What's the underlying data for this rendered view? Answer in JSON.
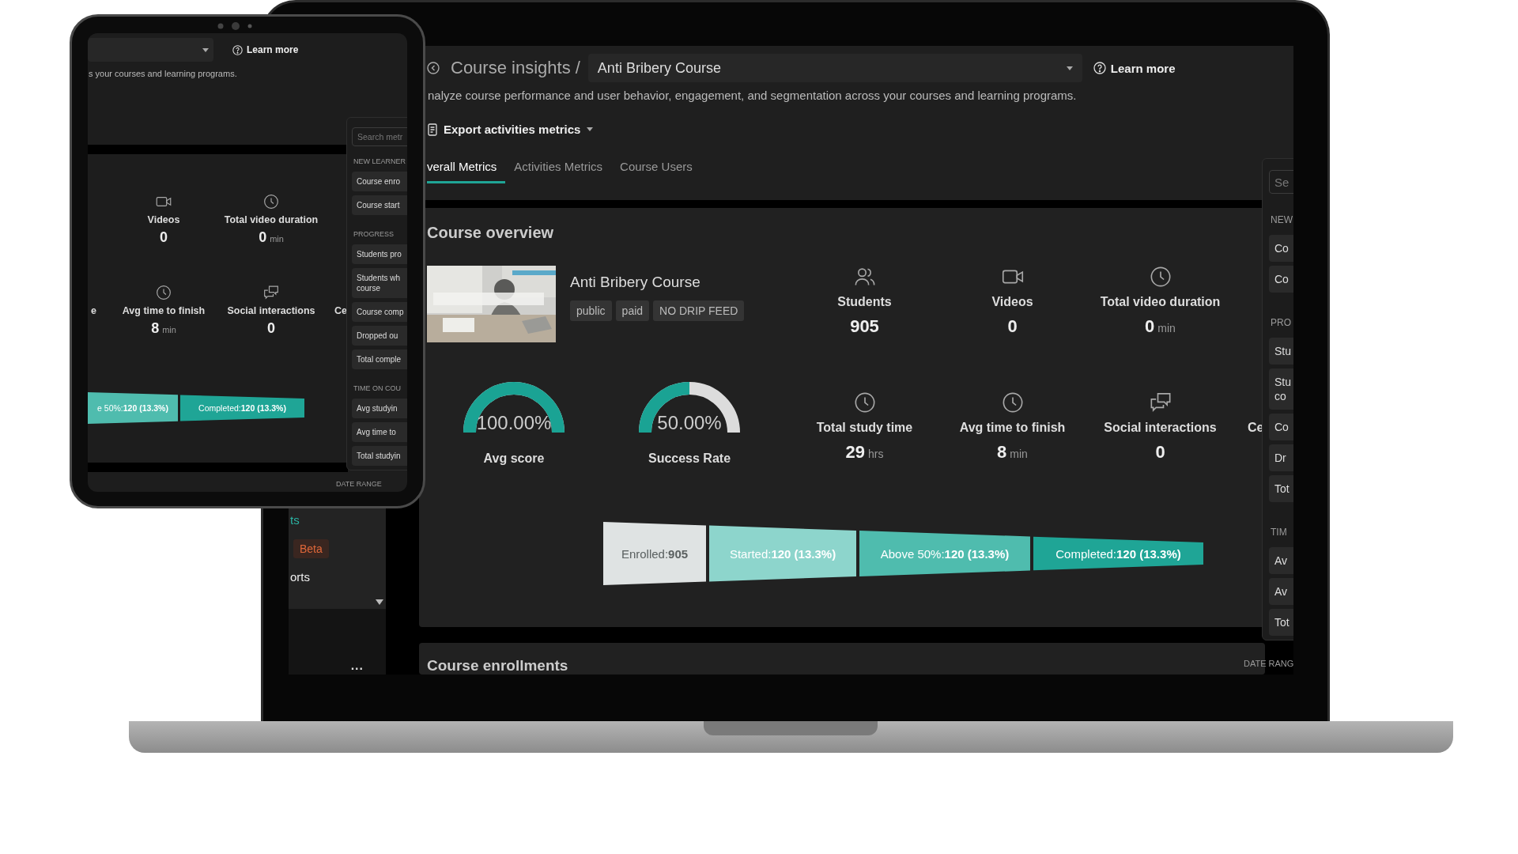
{
  "laptop": {
    "sidebar": {
      "items": [
        {
          "kind": "link",
          "label": "ts",
          "selected": true
        },
        {
          "kind": "badge",
          "label": "Beta"
        },
        {
          "kind": "link",
          "label": "orts",
          "selected": false
        }
      ],
      "more": "..."
    },
    "header": {
      "title": "Course insights /",
      "course_select": "Anti Bribery Course",
      "learn_more": "Learn more",
      "description": "nalyze course performance and user behavior, engagement, and segmentation across your courses and learning programs.",
      "export_button": "Export activities metrics"
    },
    "tabs": [
      {
        "label": "verall Metrics",
        "selected": true
      },
      {
        "label": "Activities Metrics",
        "selected": false
      },
      {
        "label": "Course Users",
        "selected": false
      }
    ],
    "overview": {
      "title": "Course overview",
      "course": {
        "name": "Anti Bribery Course",
        "thumbnail": {
          "kind": "picture"
        },
        "tags": [
          "public",
          "paid",
          "NO DRIP FEED"
        ]
      },
      "gauges": [
        {
          "value": "100.00%",
          "label": "Avg score",
          "level": 1
        },
        {
          "value": "50.00%",
          "label": "Success Rate",
          "level": 0.5
        }
      ],
      "stat_rows": [
        [
          {
            "kind": "users",
            "label": "Students",
            "value": "905"
          },
          {
            "kind": "video",
            "label": "Videos",
            "value": "0"
          },
          {
            "kind": "clock",
            "label": "Total video duration",
            "value": "0",
            "unit": "min"
          }
        ],
        [
          {
            "kind": "clock",
            "label": "Total study time",
            "value": "29",
            "unit": "hrs"
          },
          {
            "kind": "clock",
            "label": "Avg time to finish",
            "value": "8",
            "unit": "min"
          },
          {
            "kind": "chat",
            "label": "Social interactions",
            "value": "0"
          },
          {
            "kind": "clip_end",
            "label": "Ce"
          }
        ]
      ],
      "funnel": [
        {
          "label": "Enrolled:",
          "value": "905",
          "color": "#dfe3e3"
        },
        {
          "label": "Started:",
          "value": "120 (13.3%)",
          "color": "#8dd5cc"
        },
        {
          "label": "Above 50%:",
          "value": "120 (13.3%)",
          "color": "#4fbcae"
        },
        {
          "label": "Completed:",
          "value": "120 (13.3%)",
          "color": "#1fa596"
        }
      ]
    },
    "metrics_panel": {
      "search_placeholder": "Se",
      "groups": [
        {
          "title": "NEW",
          "items": [
            "Co",
            "Co"
          ]
        },
        {
          "title": "PRO",
          "items": [
            "Stu",
            "Stu\nco",
            "Co",
            "Dr",
            "Tot"
          ]
        },
        {
          "title": "TIM",
          "items": [
            "Av",
            "Av",
            "Tot"
          ]
        }
      ]
    },
    "enrollments": {
      "title": "Course enrollments",
      "date_range": "DATE RANG"
    }
  },
  "tablet": {
    "header": {
      "learn_more": "Learn more",
      "description": "s your courses and learning programs."
    },
    "stat_rows": [
      [
        {
          "kind": "video",
          "label": "Videos",
          "value": "0"
        },
        {
          "kind": "clock",
          "label": "Total video duration",
          "value": "0",
          "unit": "min"
        }
      ],
      [
        {
          "kind": "clip_start",
          "label": "e"
        },
        {
          "kind": "clock",
          "label": "Avg time to finish",
          "value": "8",
          "unit": "min"
        },
        {
          "kind": "chat",
          "label": "Social interactions",
          "value": "0"
        },
        {
          "kind": "clip_end",
          "label": "Ce"
        }
      ]
    ],
    "funnel": [
      {
        "label": "e 50%:",
        "value": "120 (13.3%)",
        "color": "#4fbcae"
      },
      {
        "label": "Completed:",
        "value": "120 (13.3%)",
        "color": "#1fa596"
      }
    ],
    "metrics_panel": {
      "search_placeholder": "Search metr",
      "groups": [
        {
          "title": "NEW LEARNER",
          "items": [
            "Course enro",
            "Course start"
          ]
        },
        {
          "title": "PROGRESS",
          "items": [
            "Students pro",
            "Students wh\ncourse",
            "Course comp",
            "Dropped ou",
            "Total comple"
          ]
        },
        {
          "title": "TIME ON COU",
          "items": [
            "Avg studyin",
            "Avg time to",
            "Total studyin"
          ]
        }
      ]
    },
    "date_range": "DATE RANGE"
  }
}
